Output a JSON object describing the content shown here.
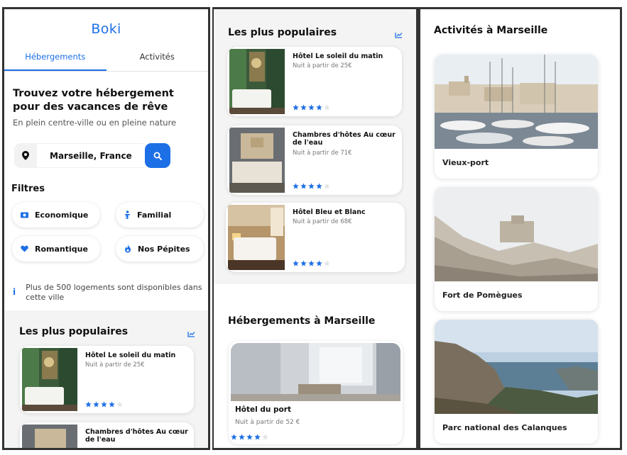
{
  "app": {
    "logo_left": "Bo",
    "logo_right": "ki"
  },
  "tabs": [
    "Hébergements",
    "Activités"
  ],
  "hero": {
    "title": "Trouvez votre hébergement pour des vacances de rêve",
    "subtitle": "En plein centre-ville ou en pleine nature"
  },
  "search": {
    "city": "Marseille, France"
  },
  "filters": {
    "title": "Filtres",
    "items": [
      "Economique",
      "Familial",
      "Romantique",
      "Nos Pépites"
    ]
  },
  "info": "Plus de 500 logements sont disponibles dans cette ville",
  "popular": {
    "title": "Les plus populaires",
    "items": [
      {
        "name": "Hôtel Le soleil du matin",
        "price": "Nuit à partir de 25€",
        "rating": 4
      },
      {
        "name": "Chambres d'hôtes Au cœur de l'eau",
        "price": "Nuit à partir de 71€",
        "rating": 4
      },
      {
        "name": "Hôtel Bleu et Blanc",
        "price": "Nuit à partir de 68€",
        "rating": 4
      }
    ]
  },
  "lodgings": {
    "title": "Hébergements à Marseille",
    "items": [
      {
        "name": "Hôtel du port",
        "price": "Nuit à partir de 52 €",
        "rating": 4
      }
    ]
  },
  "activities": {
    "title": "Activités à Marseille",
    "items": [
      "Vieux-port",
      "Fort de Pomègues",
      "Parc national des Calanques"
    ]
  },
  "colors": {
    "accent": "#1d6fe6",
    "star_empty": "#e3e3e3"
  }
}
